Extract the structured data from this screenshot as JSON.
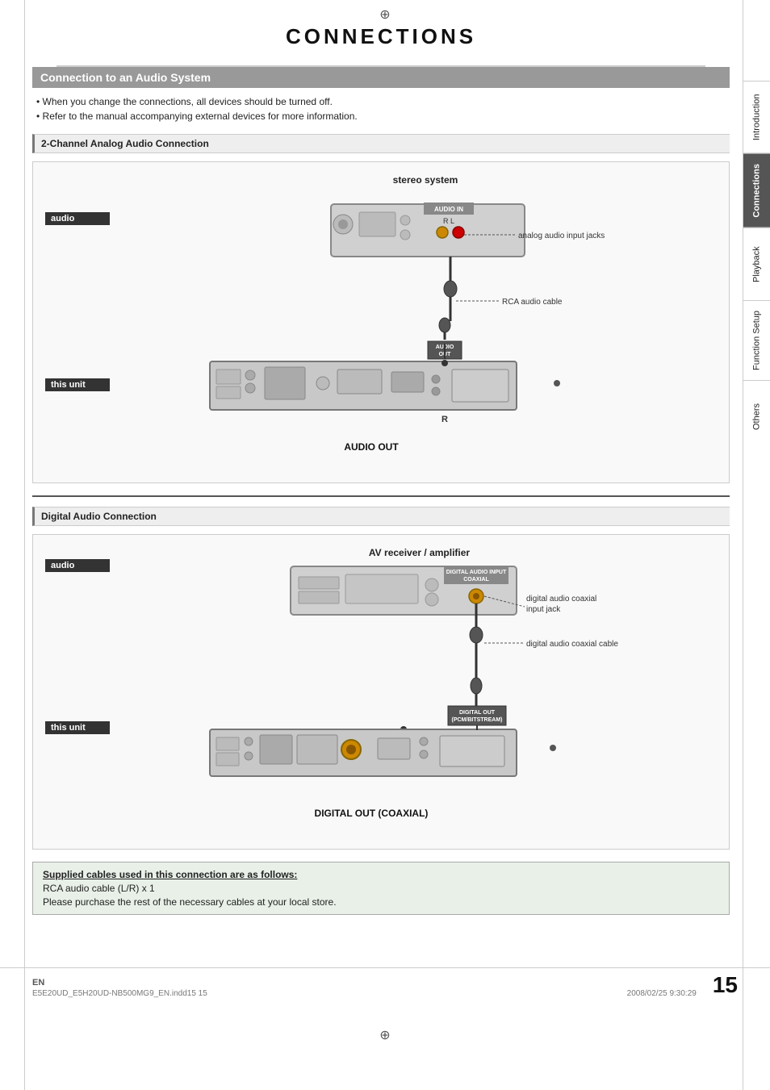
{
  "page": {
    "title": "CONNECTIONS",
    "top_crosshair": "⊕",
    "bottom_crosshair": "⊕",
    "left_crosshair_top": "—",
    "left_crosshair_bottom": "—",
    "right_crosshair_top": "—",
    "right_crosshair_bottom": "—"
  },
  "sidebar": {
    "tabs": [
      {
        "id": "introduction",
        "label": "Introduction",
        "active": false
      },
      {
        "id": "connections",
        "label": "Connections",
        "active": true
      },
      {
        "id": "playback",
        "label": "Playback",
        "active": false
      },
      {
        "id": "function-setup",
        "label": "Function Setup",
        "active": false
      },
      {
        "id": "others",
        "label": "Others",
        "active": false
      }
    ]
  },
  "main_section": {
    "header": "Connection to an Audio System",
    "bullets": [
      "When you change the connections, all devices should be turned off.",
      "Refer to the manual accompanying external devices for more information."
    ]
  },
  "analog_section": {
    "header": "2-Channel Analog Audio Connection",
    "device_title": "stereo system",
    "audio_label": "audio",
    "this_unit_label": "this unit",
    "jack_label": "analog audio input jacks",
    "cable_label": "RCA audio cable",
    "audio_in_label": "AUDIO IN",
    "audio_in_channels": "R    L",
    "audio_out_label": "AUDIO OUT",
    "port_label": "AUDIO\nOUT",
    "r_label": "R",
    "caption": "AUDIO OUT"
  },
  "digital_section": {
    "header": "Digital Audio Connection",
    "device_title": "AV receiver / amplifier",
    "audio_label": "audio",
    "this_unit_label": "this unit",
    "jack_label": "digital audio coaxial\ninput jack",
    "cable_label": "digital audio coaxial cable",
    "digital_in_label": "DIGITAL AUDIO INPUT\nCOAXIAL",
    "digital_out_label": "DIGITAL OUT\n(PCM/BITSTREAM)",
    "coaxial_label": "COAXIAL",
    "caption": "DIGITAL OUT (COAXIAL)"
  },
  "supplied_cables": {
    "title": "Supplied cables used in this connection are as follows:",
    "items": [
      "RCA audio cable (L/R) x 1",
      "Please purchase the rest of the necessary cables at your local store."
    ]
  },
  "footer": {
    "lang": "EN",
    "file": "E5E20UD_E5H20UD-NB500MG9_EN.indd15    15",
    "page_number": "15",
    "date": "2008/02/25   9:30:29"
  }
}
